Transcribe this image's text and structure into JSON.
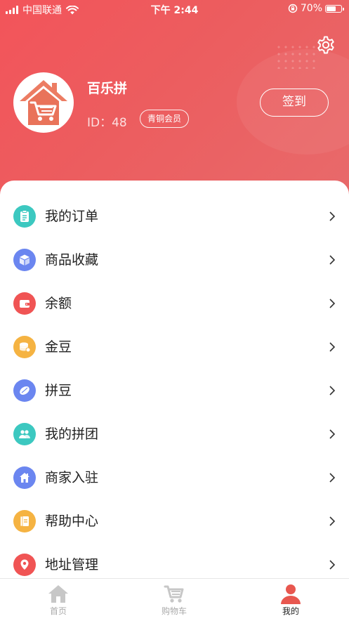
{
  "status_bar": {
    "carrier": "中国联通",
    "time": "下午 2:44",
    "battery_text": "70%",
    "battery_level": 0.7
  },
  "profile": {
    "name": "百乐拼",
    "id_text": "ID：48",
    "level": "青铜会员",
    "checkin_label": "签到"
  },
  "menu": [
    {
      "label": "我的订单",
      "icon": "order-icon",
      "color": "#3cc8c0"
    },
    {
      "label": "商品收藏",
      "icon": "cube-icon",
      "color": "#6b86f0"
    },
    {
      "label": "余额",
      "icon": "wallet-icon",
      "color": "#f05454"
    },
    {
      "label": "金豆",
      "icon": "coin-icon",
      "color": "#f5b342"
    },
    {
      "label": "拼豆",
      "icon": "bean-icon",
      "color": "#6b86f0"
    },
    {
      "label": "我的拼团",
      "icon": "group-icon",
      "color": "#3cc8c0"
    },
    {
      "label": "商家入驻",
      "icon": "store-icon",
      "color": "#6b86f0"
    },
    {
      "label": "帮助中心",
      "icon": "help-book-icon",
      "color": "#f5b342"
    },
    {
      "label": "地址管理",
      "icon": "location-pin-icon",
      "color": "#f05454"
    }
  ],
  "tabbar": {
    "tabs": [
      {
        "label": "首页",
        "icon": "home-icon"
      },
      {
        "label": "购物车",
        "icon": "cart-icon"
      },
      {
        "label": "我的",
        "icon": "user-icon",
        "active": true
      }
    ]
  },
  "colors": {
    "header_start": "#f3545a",
    "header_end": "#e86a6b",
    "active_tab": "#e8574f"
  }
}
